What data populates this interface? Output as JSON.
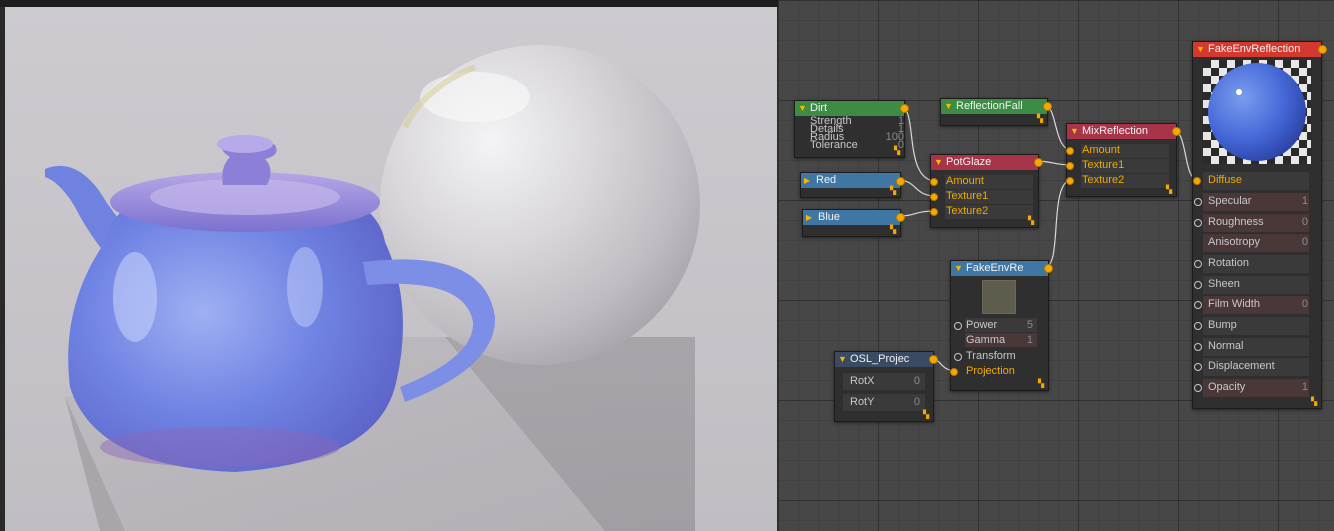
{
  "viewport": {
    "bg_color": "#c8c5cb",
    "teapot_color": "#6d7fe0"
  },
  "nodes": {
    "dirt": {
      "title": "Dirt",
      "params": [
        {
          "label": "Strength",
          "value": "1"
        },
        {
          "label": "Details",
          "value": "1"
        },
        {
          "label": "Radius",
          "value": "100"
        },
        {
          "label": "Tolerance",
          "value": "0"
        }
      ]
    },
    "reflection_fall": {
      "title": "ReflectionFall"
    },
    "pot_glaze": {
      "title": "PotGlaze",
      "inputs": [
        {
          "label": "Amount"
        },
        {
          "label": "Texture1"
        },
        {
          "label": "Texture2"
        }
      ]
    },
    "red": {
      "title": "Red",
      "color": "#d03030"
    },
    "blue": {
      "title": "Blue",
      "color": "#3050d0"
    },
    "mix_reflection": {
      "title": "MixReflection",
      "inputs": [
        {
          "label": "Amount"
        },
        {
          "label": "Texture1"
        },
        {
          "label": "Texture2"
        }
      ]
    },
    "fake_env_re": {
      "title": "FakeEnvRe",
      "params": [
        {
          "label": "Power",
          "value": "5"
        },
        {
          "label": "Gamma",
          "value": "1"
        },
        {
          "label": "Transform",
          "value": ""
        },
        {
          "label": "Projection",
          "value": ""
        }
      ]
    },
    "osl_projec": {
      "title": "OSL_Projec",
      "params": [
        {
          "label": "RotX",
          "value": "0"
        },
        {
          "label": "RotY",
          "value": "0"
        }
      ]
    },
    "fake_env_reflection": {
      "title": "FakeEnvReflection",
      "params": [
        {
          "label": "Diffuse",
          "value": ""
        },
        {
          "label": "Specular",
          "value": "1"
        },
        {
          "label": "Roughness",
          "value": "0"
        },
        {
          "label": "Anisotropy",
          "value": "0"
        },
        {
          "label": "Rotation",
          "value": ""
        },
        {
          "label": "Sheen",
          "value": ""
        },
        {
          "label": "Film Width",
          "value": "0"
        },
        {
          "label": "Bump",
          "value": ""
        },
        {
          "label": "Normal",
          "value": ""
        },
        {
          "label": "Displacement",
          "value": ""
        },
        {
          "label": "Opacity",
          "value": "1"
        }
      ]
    }
  }
}
